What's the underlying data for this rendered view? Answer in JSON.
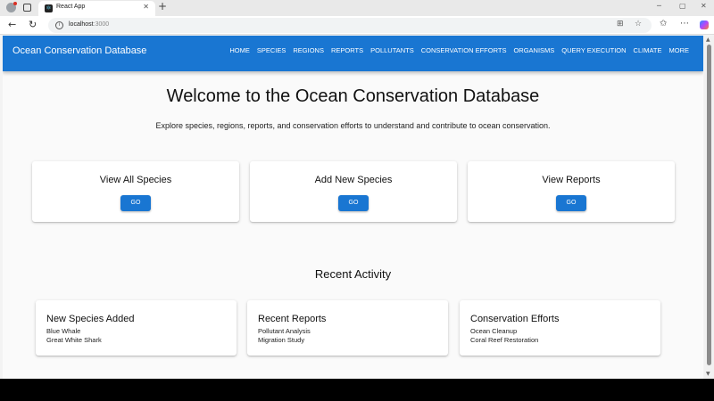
{
  "browser": {
    "tab_title": "React App",
    "url_host": "localhost",
    "url_port": ":3000"
  },
  "app": {
    "title": "Ocean Conservation Database",
    "nav": [
      "HOME",
      "SPECIES",
      "REGIONS",
      "REPORTS",
      "POLLUTANTS",
      "CONSERVATION EFFORTS",
      "ORGANISMS",
      "QUERY EXECUTION",
      "CLIMATE",
      "MORE"
    ]
  },
  "hero": {
    "title": "Welcome to the Ocean Conservation Database",
    "subtitle": "Explore species, regions, reports, and conservation efforts to understand and contribute to ocean conservation."
  },
  "actions": [
    {
      "title": "View All Species",
      "button": "GO"
    },
    {
      "title": "Add New Species",
      "button": "GO"
    },
    {
      "title": "View Reports",
      "button": "GO"
    }
  ],
  "recent": {
    "title": "Recent Activity",
    "cards": [
      {
        "title": "New Species Added",
        "items": [
          "Blue Whale",
          "Great White Shark"
        ]
      },
      {
        "title": "Recent Reports",
        "items": [
          "Pollutant Analysis",
          "Migration Study"
        ]
      },
      {
        "title": "Conservation Efforts",
        "items": [
          "Ocean Cleanup",
          "Coral Reef Restoration"
        ]
      }
    ]
  },
  "colors": {
    "primary": "#1976d2",
    "background": "#fafafa"
  }
}
